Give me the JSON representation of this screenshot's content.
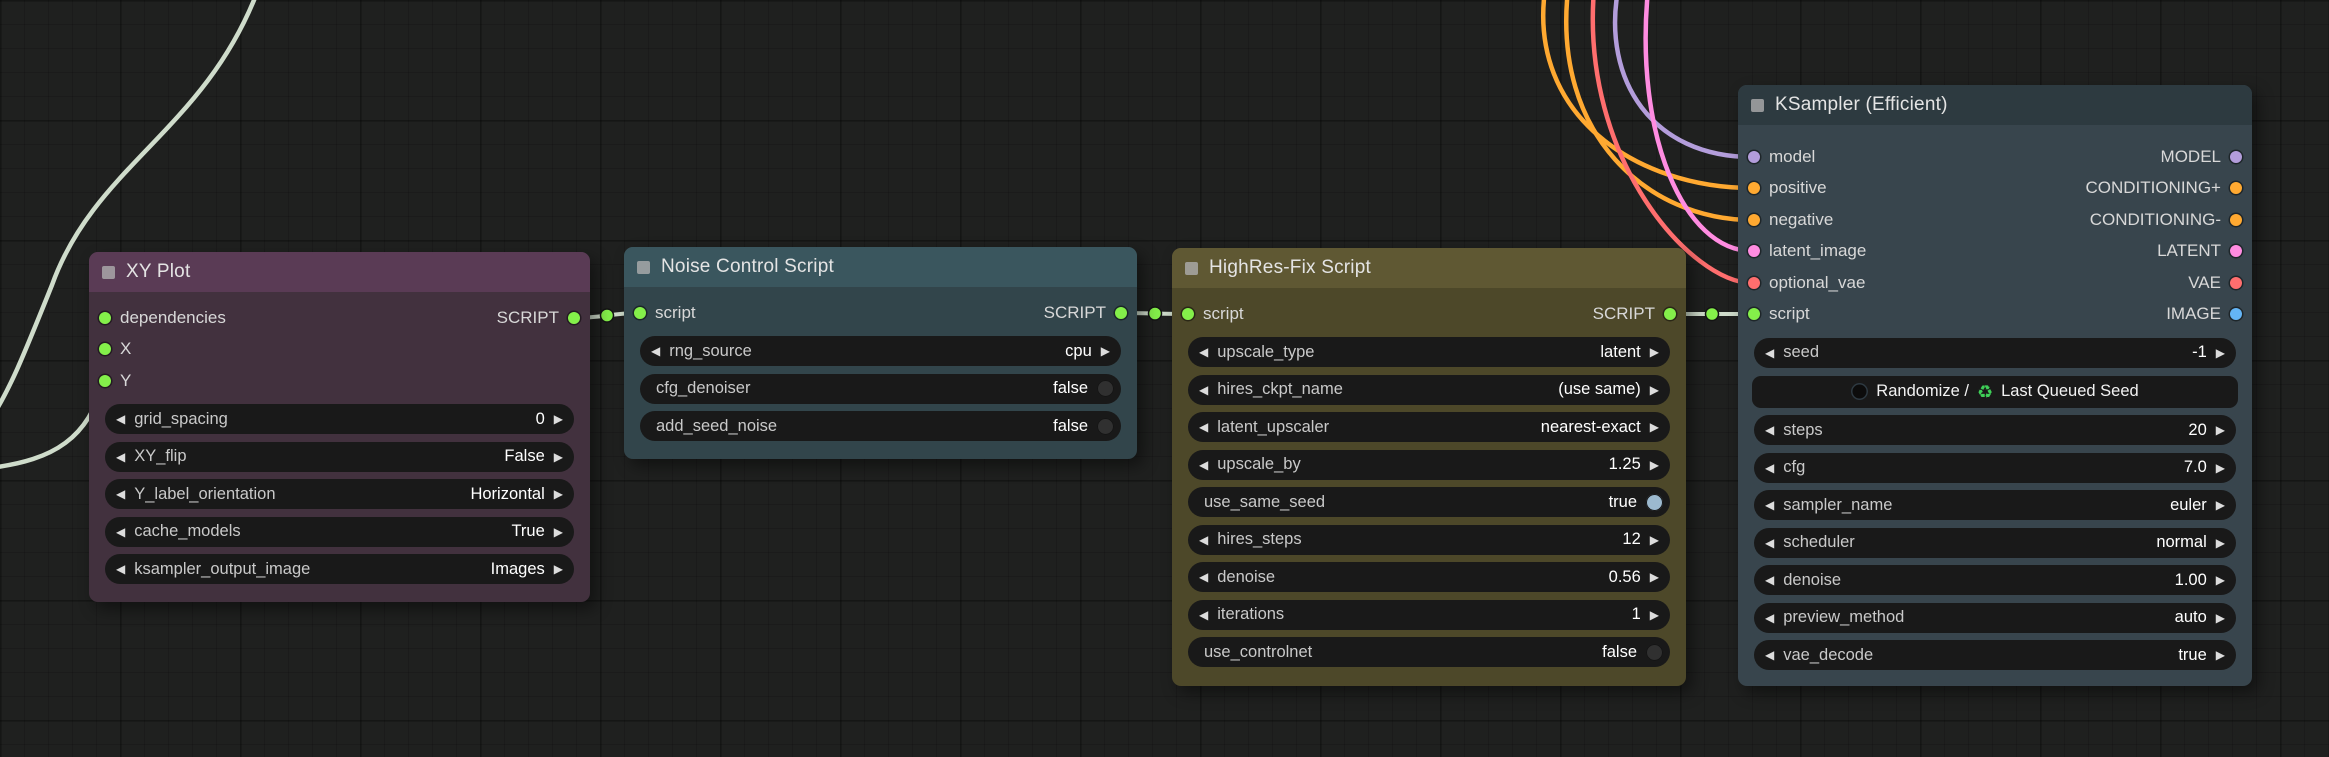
{
  "palette": {
    "canvas_background": "#1f201f",
    "script_link": "#cfdccb",
    "script_dot": "#84ef4a",
    "model": "#b39ddb",
    "conditioning": "#ffa931",
    "latent": "#ff8ce1",
    "vae": "#ff6e6e",
    "image": "#64b5f6",
    "toggle_on": "#9cb9cf",
    "toggle_off": "#303030",
    "recycle_green": "#3ecf57"
  },
  "icons": {
    "arrow_left": "◀",
    "arrow_right": "▶",
    "recycle": "♻"
  },
  "nodes": {
    "xy_plot": {
      "title": "XY Plot",
      "inputs": [
        {
          "label": "dependencies"
        },
        {
          "label": "X"
        },
        {
          "label": "Y"
        }
      ],
      "outputs": [
        {
          "label": "SCRIPT"
        }
      ],
      "widgets": [
        {
          "label": "grid_spacing",
          "value": "0"
        },
        {
          "label": "XY_flip",
          "value": "False"
        },
        {
          "label": "Y_label_orientation",
          "value": "Horizontal"
        },
        {
          "label": "cache_models",
          "value": "True"
        },
        {
          "label": "ksampler_output_image",
          "value": "Images"
        }
      ]
    },
    "noise_control": {
      "title": "Noise Control Script",
      "inputs": [
        {
          "label": "script"
        }
      ],
      "outputs": [
        {
          "label": "SCRIPT"
        }
      ],
      "widgets": [
        {
          "label": "rng_source",
          "value": "cpu"
        },
        {
          "label": "cfg_denoiser",
          "value": "false"
        },
        {
          "label": "add_seed_noise",
          "value": "false"
        }
      ]
    },
    "highres_fix": {
      "title": "HighRes-Fix Script",
      "inputs": [
        {
          "label": "script"
        }
      ],
      "outputs": [
        {
          "label": "SCRIPT"
        }
      ],
      "widgets": [
        {
          "label": "upscale_type",
          "value": "latent"
        },
        {
          "label": "hires_ckpt_name",
          "value": "(use same)"
        },
        {
          "label": "latent_upscaler",
          "value": "nearest-exact"
        },
        {
          "label": "upscale_by",
          "value": "1.25"
        },
        {
          "label": "use_same_seed",
          "value": "true"
        },
        {
          "label": "hires_steps",
          "value": "12"
        },
        {
          "label": "denoise",
          "value": "0.56"
        },
        {
          "label": "iterations",
          "value": "1"
        },
        {
          "label": "use_controlnet",
          "value": "false"
        }
      ]
    },
    "ksampler": {
      "title": "KSampler (Efficient)",
      "slots": [
        {
          "in": "model",
          "out": "MODEL"
        },
        {
          "in": "positive",
          "out": "CONDITIONING+"
        },
        {
          "in": "negative",
          "out": "CONDITIONING-"
        },
        {
          "in": "latent_image",
          "out": "LATENT"
        },
        {
          "in": "optional_vae",
          "out": "VAE"
        },
        {
          "in": "script",
          "out": "IMAGE"
        }
      ],
      "widgets": [
        {
          "label": "seed",
          "value": "-1"
        },
        {
          "label": "steps",
          "value": "20"
        },
        {
          "label": "cfg",
          "value": "7.0"
        },
        {
          "label": "sampler_name",
          "value": "euler"
        },
        {
          "label": "scheduler",
          "value": "normal"
        },
        {
          "label": "denoise",
          "value": "1.00"
        },
        {
          "label": "preview_method",
          "value": "auto"
        },
        {
          "label": "vae_decode",
          "value": "true"
        }
      ],
      "seed_button": {
        "part1": "Randomize /",
        "part2": "Last Queued Seed",
        "recycle": "♻"
      }
    }
  }
}
